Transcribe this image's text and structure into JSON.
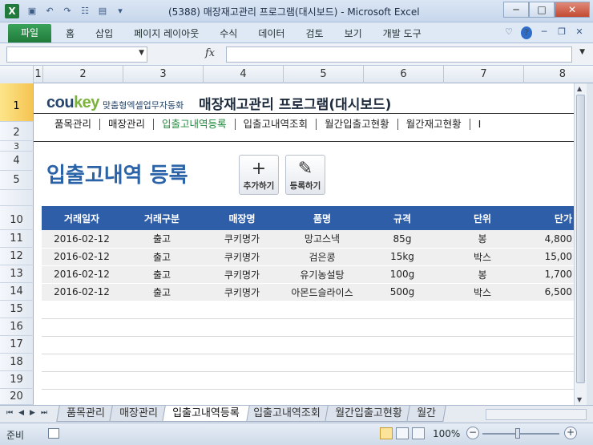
{
  "window": {
    "title": "(5388) 매장재고관리 프로그램(대시보드)  -  Microsoft Excel",
    "app_icon_letter": "X",
    "controls": {
      "minimize": "─",
      "maximize": "□",
      "close": "✕"
    }
  },
  "ribbon": {
    "file_tab": "파일",
    "tabs": [
      "홈",
      "삽입",
      "페이지 레이아웃",
      "수식",
      "데이터",
      "검토",
      "보기",
      "개발 도구"
    ],
    "help": "?"
  },
  "formula_bar": {
    "fx": "fx",
    "name_box": "",
    "value": ""
  },
  "columns": [
    "1",
    "2",
    "3",
    "4",
    "5",
    "6",
    "7",
    "8"
  ],
  "rows": [
    "1",
    "2",
    "3",
    "4",
    "5",
    "10",
    "11",
    "12",
    "13",
    "14",
    "15",
    "16",
    "17",
    "18",
    "19",
    "20"
  ],
  "dashboard": {
    "brand_prefix": "cou",
    "brand_suffix": "key",
    "tagline": "맞춤형엑셀업무자동화",
    "app_title": "매장재고관리 프로그램(대시보드)",
    "nav": [
      "품목관리",
      "매장관리",
      "입출고내역등록",
      "입출고내역조회",
      "월간입출고현황",
      "월간재고현황",
      "I"
    ],
    "page_title": "입출고내역 등록",
    "add_button": {
      "icon": "+",
      "label": "추가하기"
    },
    "register_button": {
      "icon": "✎",
      "label": "등록하기"
    }
  },
  "table": {
    "headers": [
      "거래일자",
      "거래구분",
      "매장명",
      "품명",
      "규격",
      "단위",
      "단가"
    ],
    "rows": [
      [
        "2016-02-12",
        "출고",
        "쿠키명가",
        "망고스낵",
        "85g",
        "봉",
        "4,800"
      ],
      [
        "2016-02-12",
        "출고",
        "쿠키명가",
        "검은콩",
        "15kg",
        "박스",
        "15,00"
      ],
      [
        "2016-02-12",
        "출고",
        "쿠키명가",
        "유기농설탕",
        "100g",
        "봉",
        "1,700"
      ],
      [
        "2016-02-12",
        "출고",
        "쿠키명가",
        "아몬드슬라이스",
        "500g",
        "박스",
        "6,500"
      ]
    ]
  },
  "sheet_tabs": [
    "품목관리",
    "매장관리",
    "입출고내역등록",
    "입출고내역조회",
    "월간입출고현황",
    "월간"
  ],
  "active_sheet": "입출고내역등록",
  "status": {
    "ready": "준비",
    "zoom": "100%",
    "zoom_percent": 100
  }
}
